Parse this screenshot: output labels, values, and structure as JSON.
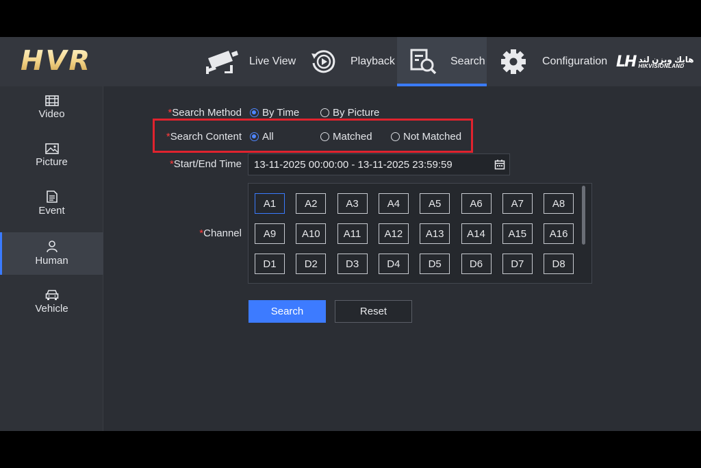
{
  "header": {
    "logo": "HVR",
    "nav": [
      {
        "label": "Live View",
        "icon": "camera-icon"
      },
      {
        "label": "Playback",
        "icon": "playback-icon"
      },
      {
        "label": "Search",
        "icon": "search-doc-icon",
        "active": true
      },
      {
        "label": "Configuration",
        "icon": "gear-icon"
      }
    ],
    "brand": {
      "mark": "LH",
      "arabic": "هايك ويزن لند",
      "english": "HIKVISIONLAND"
    }
  },
  "sidebar": {
    "items": [
      {
        "label": "Video",
        "icon": "video-icon"
      },
      {
        "label": "Picture",
        "icon": "picture-icon"
      },
      {
        "label": "Event",
        "icon": "event-icon"
      },
      {
        "label": "Human",
        "icon": "human-icon",
        "active": true
      },
      {
        "label": "Vehicle",
        "icon": "vehicle-icon"
      }
    ]
  },
  "form": {
    "search_method": {
      "label": "Search Method",
      "options": [
        "By Time",
        "By Picture"
      ],
      "selected": "By Time"
    },
    "search_content": {
      "label": "Search Content",
      "options": [
        "All",
        "Matched",
        "Not Matched"
      ],
      "selected": "All"
    },
    "time": {
      "label": "Start/End Time",
      "value": "13-11-2025 00:00:00 - 13-11-2025 23:59:59"
    },
    "channel": {
      "label": "Channel",
      "rows": [
        [
          "A1",
          "A2",
          "A3",
          "A4",
          "A5",
          "A6",
          "A7",
          "A8"
        ],
        [
          "A9",
          "A10",
          "A11",
          "A12",
          "A13",
          "A14",
          "A15",
          "A16"
        ],
        [
          "D1",
          "D2",
          "D3",
          "D4",
          "D5",
          "D6",
          "D7",
          "D8"
        ]
      ],
      "selected": "A1"
    },
    "required_mark": "*"
  },
  "buttons": {
    "search": "Search",
    "reset": "Reset"
  },
  "colors": {
    "accent": "#3d7bff",
    "highlight": "#e0232e",
    "required": "#ff3b3b"
  }
}
